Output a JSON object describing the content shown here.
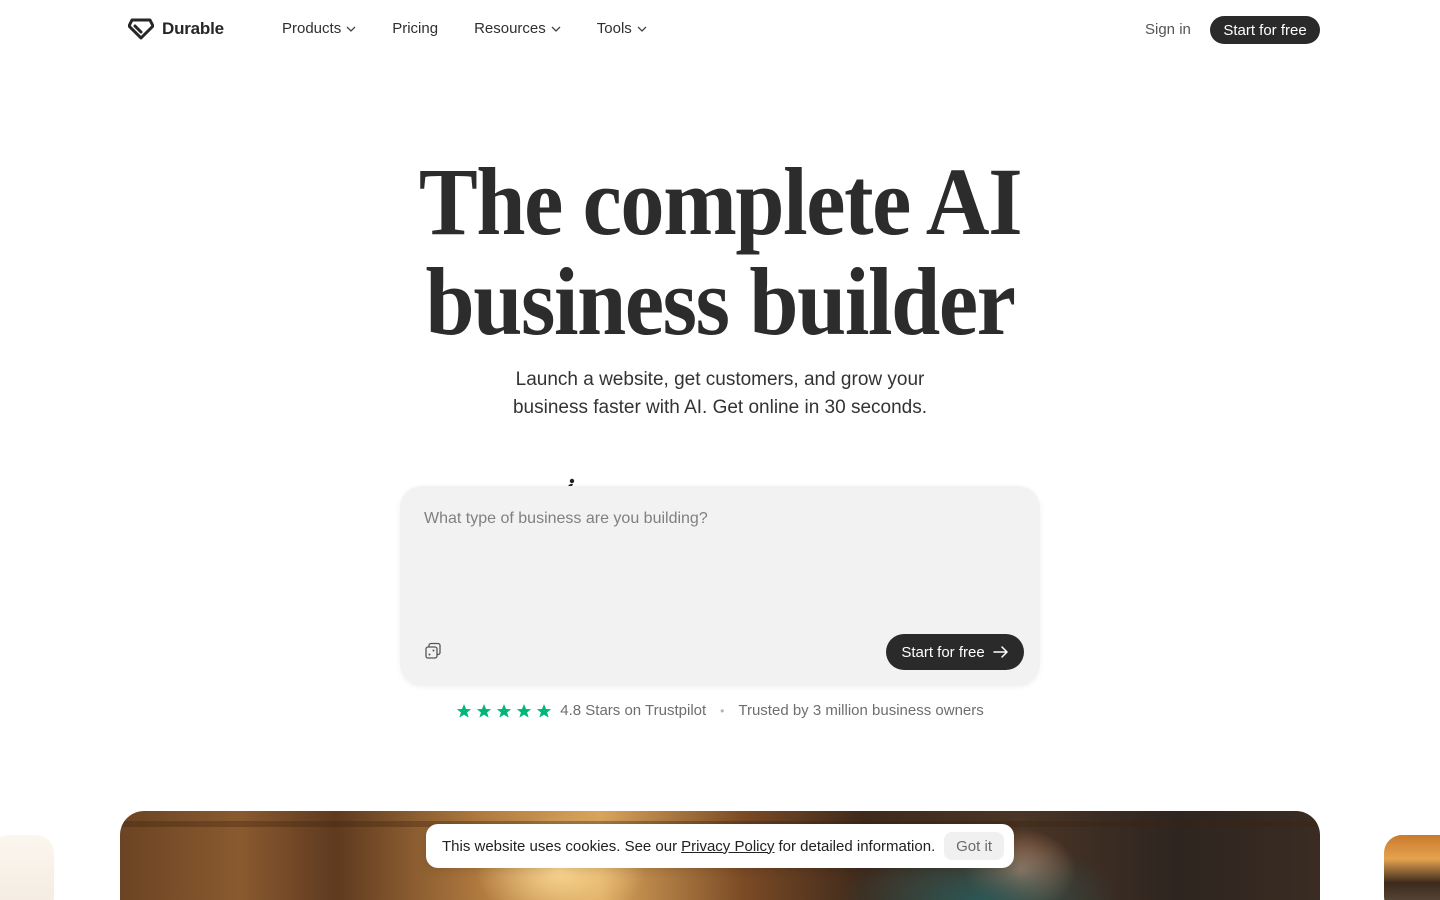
{
  "nav": {
    "logo_text": "Durable",
    "items": [
      {
        "label": "Products",
        "has_dropdown": true
      },
      {
        "label": "Pricing",
        "has_dropdown": false
      },
      {
        "label": "Resources",
        "has_dropdown": true
      },
      {
        "label": "Tools",
        "has_dropdown": true
      }
    ],
    "sign_in": "Sign in",
    "start_button": "Start for free"
  },
  "hero": {
    "title_line1": "The complete AI",
    "title_line2": "business builder",
    "subtitle_line1": "Launch a website, get customers, and grow your",
    "subtitle_line2": "business faster with AI. Get online in 30 seconds."
  },
  "prompt": {
    "placeholder": "What type of business are you building?",
    "value": "",
    "shuffle_icon": "dice-icon",
    "start_button": "Start for free",
    "start_icon": "arrow-right-icon"
  },
  "rating": {
    "stars": 5,
    "star_color": "#00b67a",
    "text": "4.8 Stars on Trustpilot",
    "separator": "•",
    "trusted": "Trusted by 3 million business owners"
  },
  "cookie": {
    "text_before": "This website uses cookies. See our",
    "link": "Privacy Policy",
    "text_after": "for detailed information.",
    "button": "Got it"
  },
  "colors": {
    "primary_button": "#2a2a2a",
    "prompt_bg": "#f2f2f2",
    "text": "#2c2c2c"
  }
}
